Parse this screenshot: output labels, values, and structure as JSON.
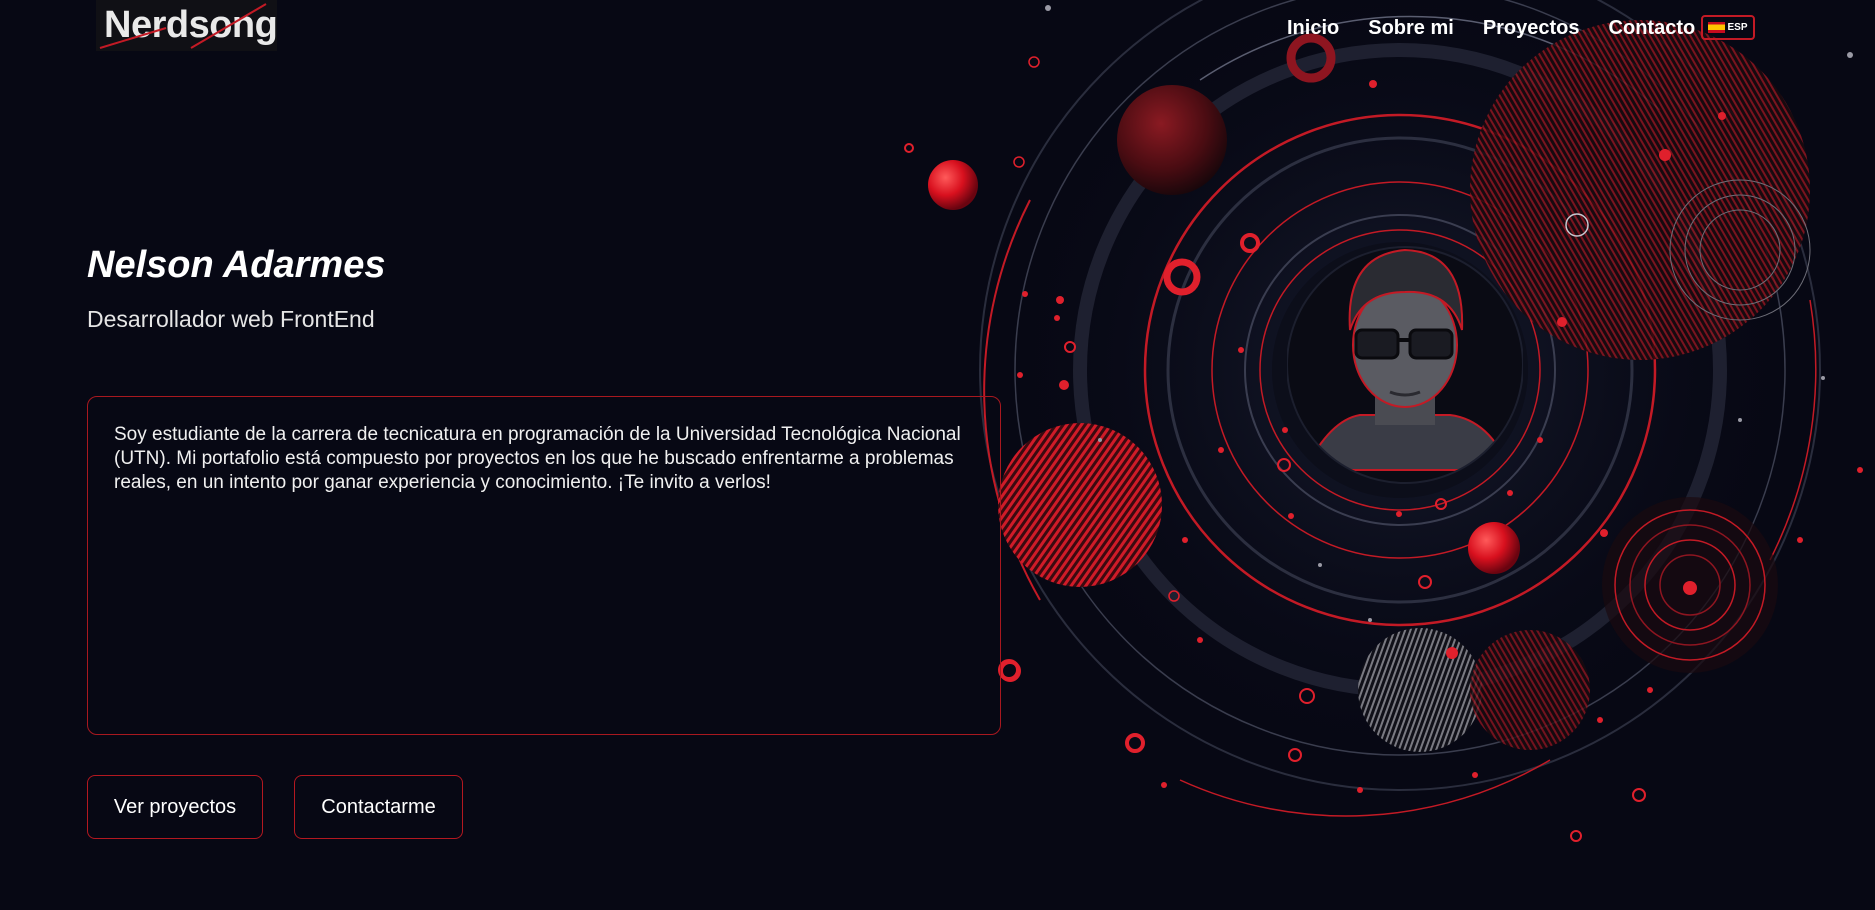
{
  "header": {
    "logo_text": "Nerdsong",
    "nav": [
      {
        "label": "Inicio"
      },
      {
        "label": "Sobre mi"
      },
      {
        "label": "Proyectos"
      },
      {
        "label": "Contacto"
      }
    ],
    "language": {
      "label": "ESP",
      "flag": "spain-flag-icon"
    }
  },
  "hero": {
    "name": "Nelson Adarmes",
    "role": "Desarrollador web FrontEnd",
    "bio": "Soy estudiante de la carrera de tecnicatura en programación de la Universidad Tecnológica Nacional (UTN). Mi portafolio está compuesto por proyectos en los que he buscado enfrentarme a problemas reales, en un intento por ganar experiencia y conocimiento. ¡Te invito a verlos!",
    "buttons": {
      "projects": "Ver proyectos",
      "contact": "Contactarme"
    }
  },
  "colors": {
    "background": "#070814",
    "accent": "#c31a25",
    "text": "#ffffff"
  }
}
